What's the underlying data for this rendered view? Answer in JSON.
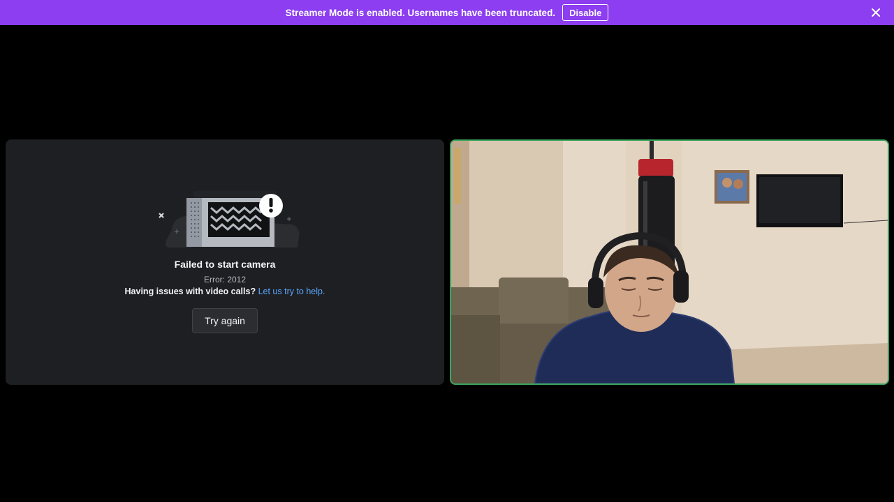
{
  "banner": {
    "message": "Streamer Mode is enabled. Usernames have been truncated.",
    "disable_label": "Disable",
    "close_icon": "close-icon",
    "color": "#8c3ef0"
  },
  "left_tile": {
    "illustration_icon": "camera-error-illustration",
    "title": "Failed to start camera",
    "error_code": "Error: 2012",
    "help_question": "Having issues with video calls?",
    "help_link": "Let us try to help.",
    "retry_label": "Try again"
  },
  "right_tile": {
    "content": "camera-video-feed",
    "speaking_border_color": "#3ba55c"
  }
}
